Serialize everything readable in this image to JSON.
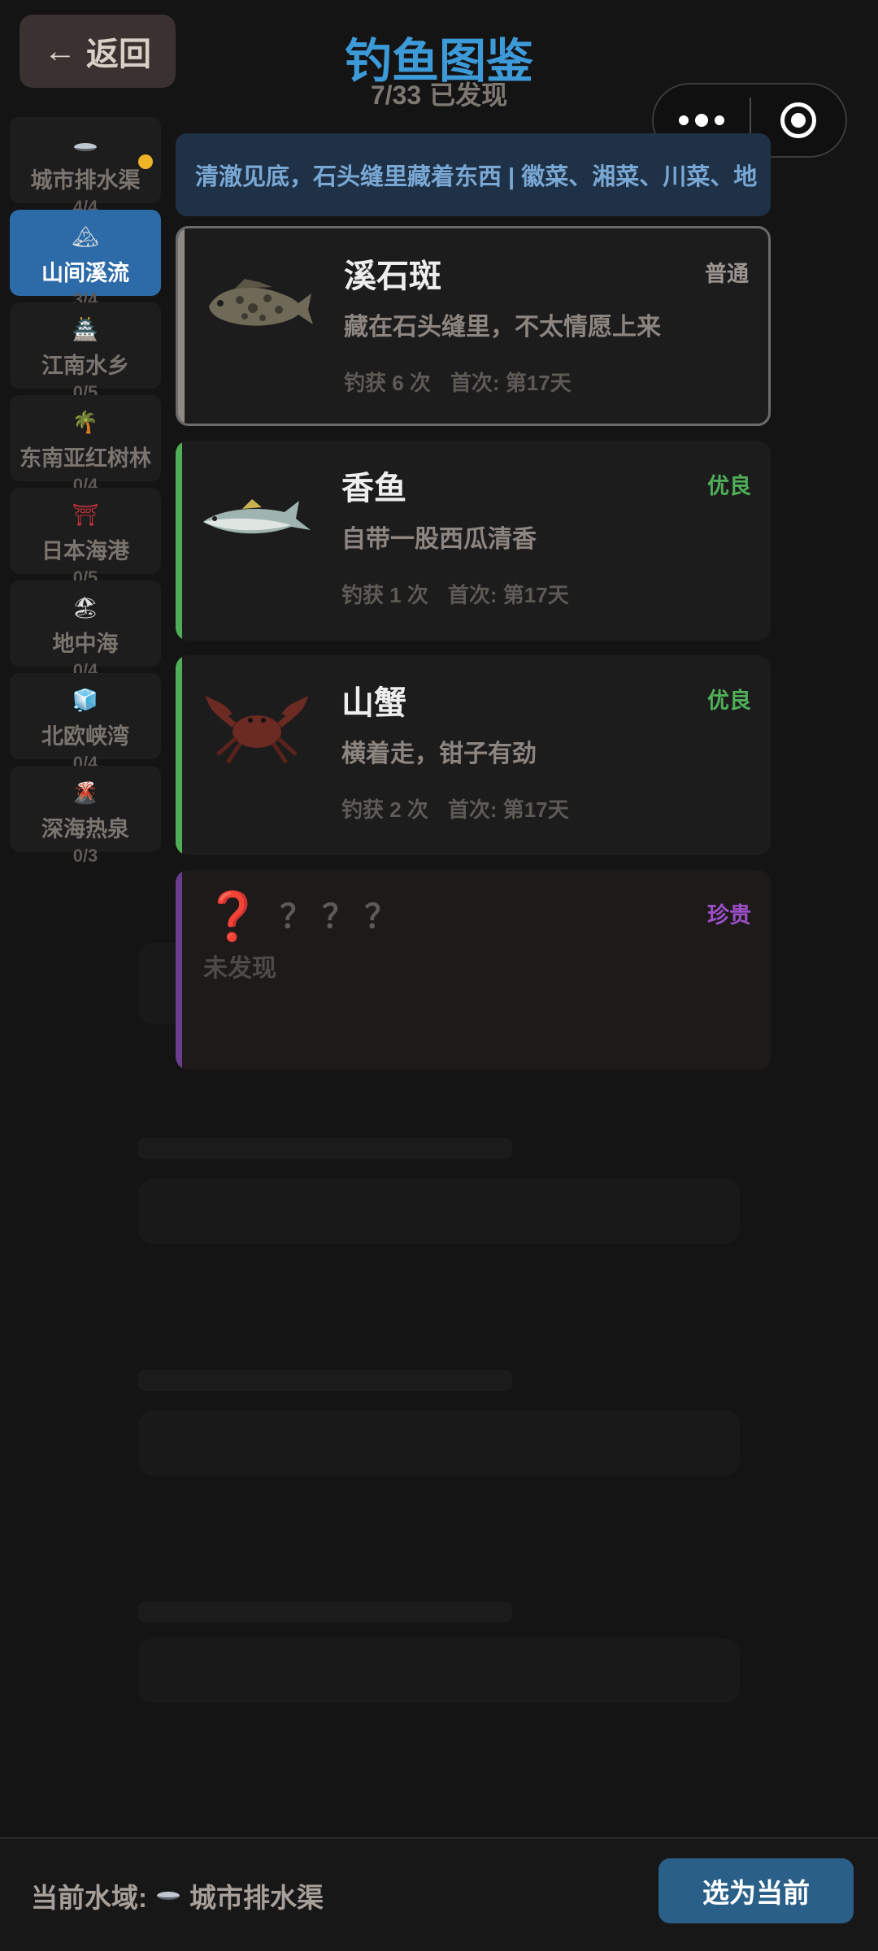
{
  "header": {
    "back_label": "返回",
    "title": "钓鱼图鉴",
    "progress": "7/33",
    "progress_suffix": "已发现"
  },
  "sidebar": {
    "items": [
      {
        "label": "城市排水渠",
        "count": "4/4",
        "icon": "drain-icon",
        "has_dot": true
      },
      {
        "label": "山间溪流",
        "count": "3/4",
        "icon": "mountain-icon",
        "active": true
      },
      {
        "label": "江南水乡",
        "count": "0/5",
        "icon": "pagoda-icon"
      },
      {
        "label": "东南亚红树林",
        "count": "0/4",
        "icon": "palm-tree-icon"
      },
      {
        "label": "日本海港",
        "count": "0/5",
        "icon": "torii-icon"
      },
      {
        "label": "地中海",
        "count": "0/4",
        "icon": "beach-umbrella-icon"
      },
      {
        "label": "北欧峡湾",
        "count": "0/4",
        "icon": "ice-cube-icon"
      },
      {
        "label": "深海热泉",
        "count": "0/3",
        "icon": "volcano-icon"
      }
    ]
  },
  "banner": {
    "text": "清澈见底，石头缝里藏着东西 | 徽菜、湘菜、川菜、地"
  },
  "fish_list": [
    {
      "name": "溪石斑",
      "rarity": "普通",
      "rarity_color": "#9a9590",
      "desc": "藏在石头缝里，不太情愿上来",
      "catch_count": "钓获 6 次",
      "first_catch": "首次: 第17天",
      "icon": "stone-grouper-icon"
    },
    {
      "name": "香鱼",
      "rarity": "优良",
      "rarity_color": "#4fae58",
      "desc": "自带一股西瓜清香",
      "catch_count": "钓获 1 次",
      "first_catch": "首次: 第17天",
      "icon": "sweetfish-icon"
    },
    {
      "name": "山蟹",
      "rarity": "优良",
      "rarity_color": "#4fae58",
      "desc": "横着走，钳子有劲",
      "catch_count": "钓获 2 次",
      "first_catch": "首次: 第17天",
      "icon": "mountain-crab-icon"
    },
    {
      "name": "？？？",
      "rarity": "珍贵",
      "rarity_color": "#9b4fc8",
      "desc": "未发现",
      "icon": "question-mark-icon"
    }
  ],
  "footer": {
    "current_label": "当前水域:",
    "current_value": "城市排水渠",
    "select_label": "选为当前"
  },
  "colors": {
    "background": "#141414",
    "accent_blue": "#3d9ad8",
    "common": "#9a9590",
    "fine": "#4fae58",
    "rare": "#9b4fc8"
  }
}
